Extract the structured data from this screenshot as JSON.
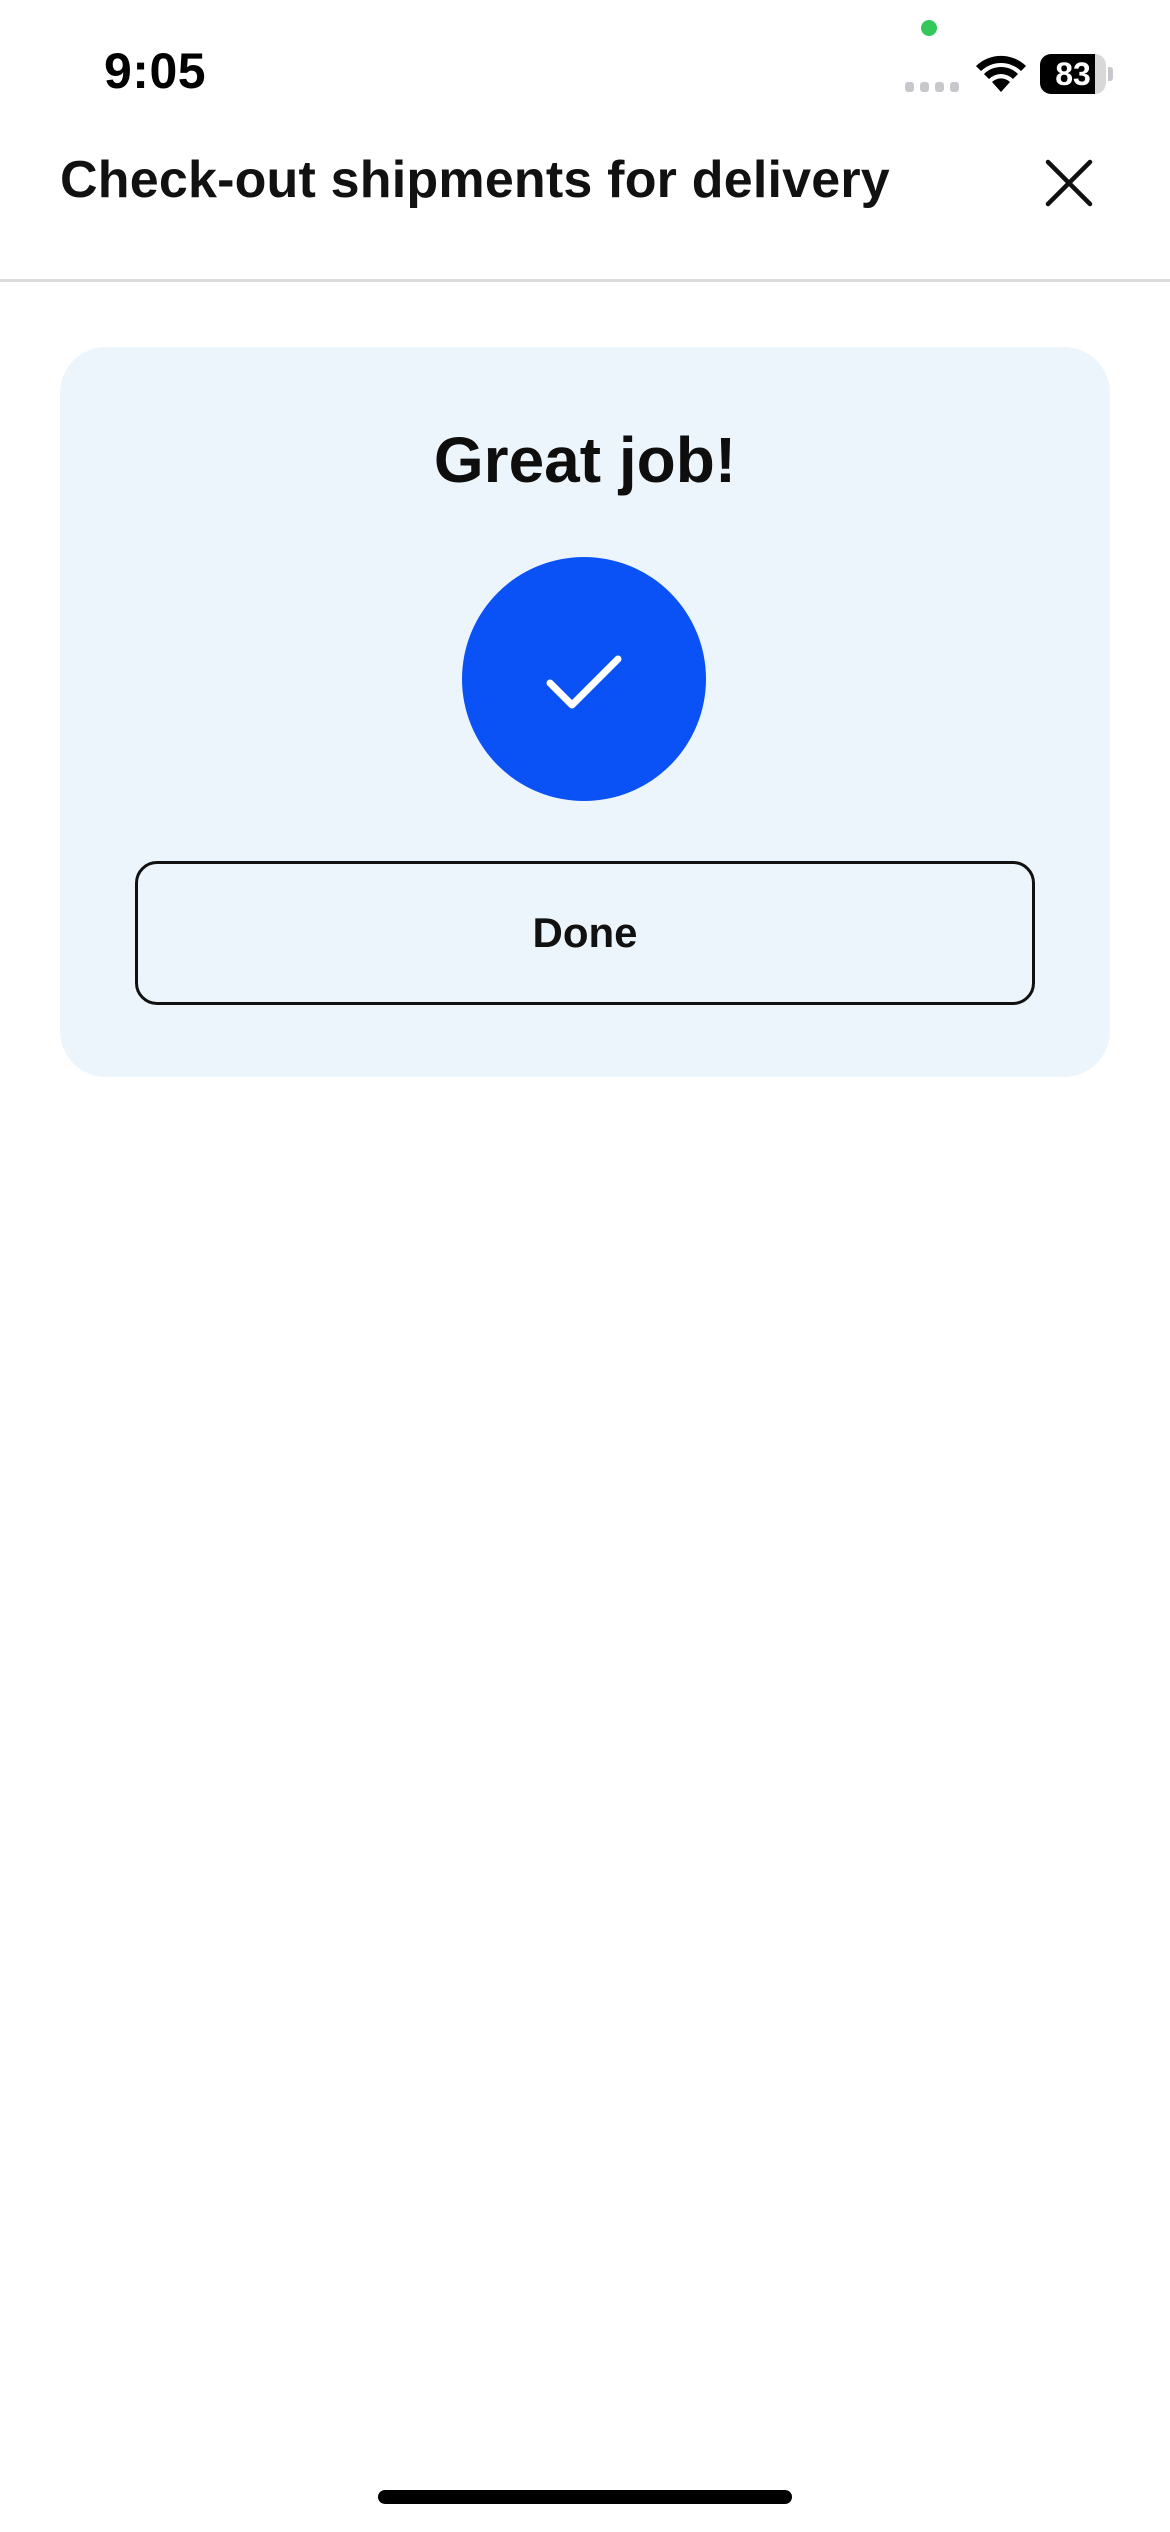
{
  "status_bar": {
    "time": "9:05",
    "battery_percent": "83",
    "battery_level": 0.83,
    "mic_indicator_color": "#34c759",
    "icons": [
      "cellular-signal-icon",
      "wifi-icon",
      "battery-icon"
    ]
  },
  "header": {
    "title": "Check-out shipments for delivery",
    "close_icon": "close-icon"
  },
  "success_card": {
    "title": "Great job!",
    "icon": "checkmark-icon",
    "accent_color": "#0a52f5",
    "card_background": "#edf5fc",
    "done_label": "Done"
  }
}
